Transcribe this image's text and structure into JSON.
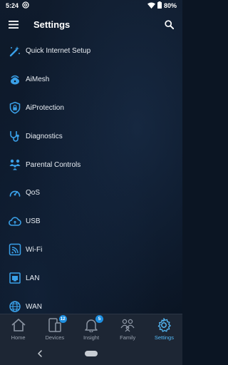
{
  "status_bar": {
    "time": "5:24",
    "battery": "80%"
  },
  "app_bar": {
    "title": "Settings",
    "menu_icon": "hamburger-menu-icon",
    "search_icon": "search-icon"
  },
  "settings": [
    {
      "label": "Quick Internet Setup",
      "icon": "wand-icon"
    },
    {
      "label": "AiMesh",
      "icon": "mesh-router-icon"
    },
    {
      "label": "AiProtection",
      "icon": "shield-lock-icon"
    },
    {
      "label": "Diagnostics",
      "icon": "stethoscope-icon"
    },
    {
      "label": "Parental Controls",
      "icon": "family-icon"
    },
    {
      "label": "QoS",
      "icon": "speedometer-icon"
    },
    {
      "label": "USB",
      "icon": "cloud-usb-icon"
    },
    {
      "label": "Wi-Fi",
      "icon": "wifi-icon"
    },
    {
      "label": "LAN",
      "icon": "lan-port-icon"
    },
    {
      "label": "WAN",
      "icon": "globe-icon"
    }
  ],
  "bottom_nav": [
    {
      "label": "Home",
      "icon": "home-icon",
      "badge": ""
    },
    {
      "label": "Devices",
      "icon": "devices-icon",
      "badge": "12"
    },
    {
      "label": "Insight",
      "icon": "bell-icon",
      "badge": "5"
    },
    {
      "label": "Family",
      "icon": "family-icon",
      "badge": ""
    },
    {
      "label": "Settings",
      "icon": "gear-icon",
      "badge": "",
      "active": true
    }
  ],
  "colors": {
    "accent": "#55b8f5",
    "icon_blue": "#3aa0e8",
    "badge": "#1e8fe0",
    "nav_bg": "#1d2634"
  }
}
